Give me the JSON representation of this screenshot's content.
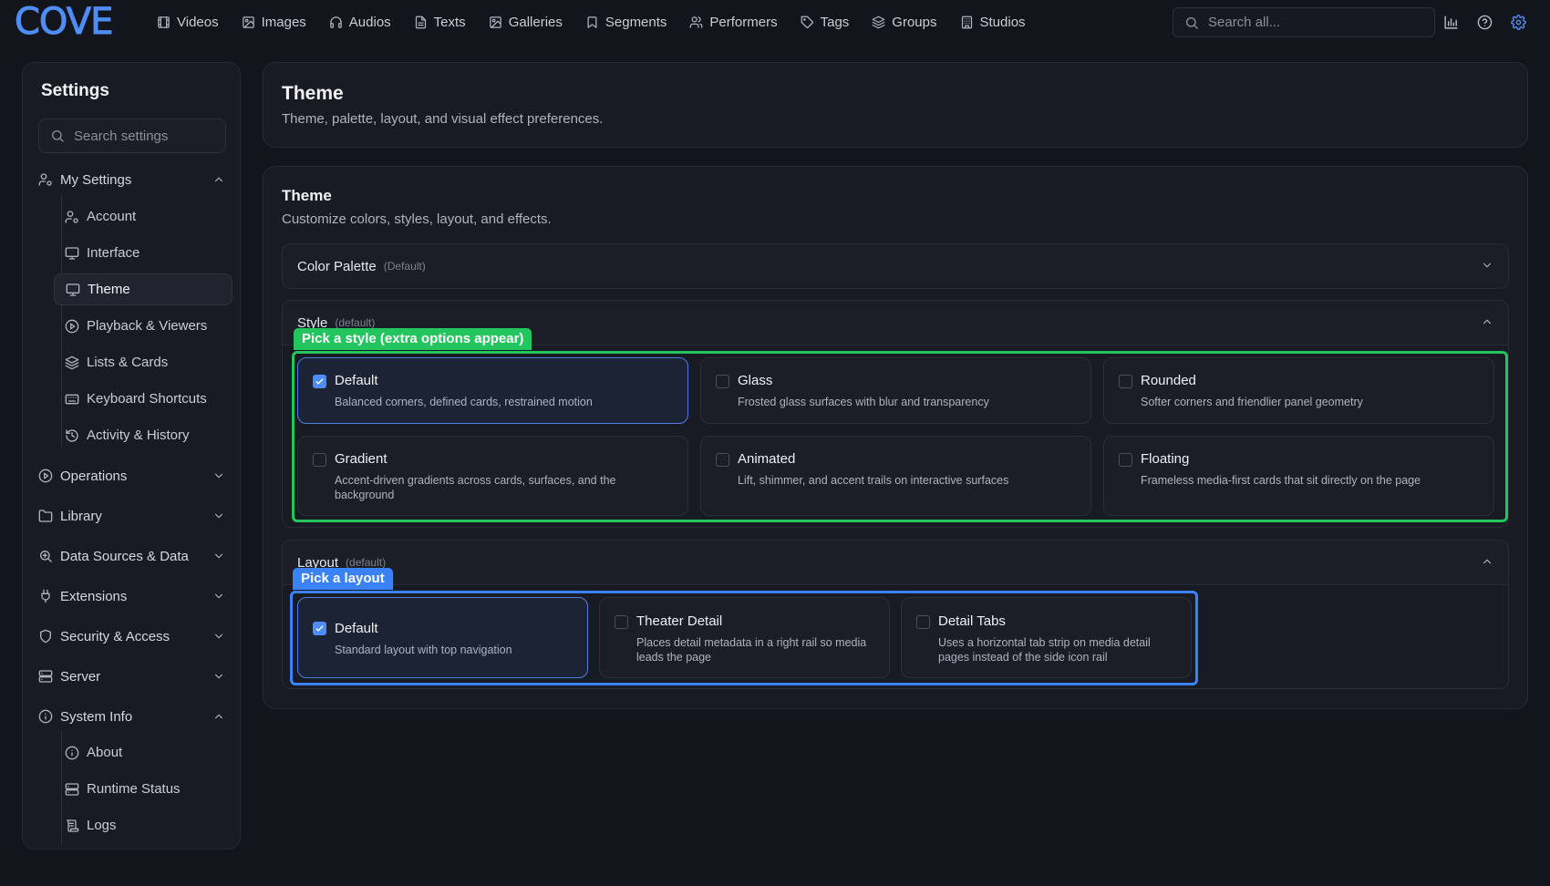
{
  "app": {
    "logo": "COVE"
  },
  "nav": [
    {
      "label": "Videos",
      "icon": "film-icon"
    },
    {
      "label": "Images",
      "icon": "image-icon"
    },
    {
      "label": "Audios",
      "icon": "headphones-icon"
    },
    {
      "label": "Texts",
      "icon": "file-text-icon"
    },
    {
      "label": "Galleries",
      "icon": "gallery-icon"
    },
    {
      "label": "Segments",
      "icon": "bookmark-icon"
    },
    {
      "label": "Performers",
      "icon": "users-icon"
    },
    {
      "label": "Tags",
      "icon": "tag-icon"
    },
    {
      "label": "Groups",
      "icon": "layers-icon"
    },
    {
      "label": "Studios",
      "icon": "building-icon"
    }
  ],
  "search": {
    "placeholder": "Search all..."
  },
  "colors": {
    "accent": "#4e8df5",
    "style_highlight": "#22c55e",
    "layout_highlight": "#3b82f6"
  },
  "sidebar": {
    "title": "Settings",
    "search_placeholder": "Search settings",
    "my_settings": {
      "label": "My Settings",
      "items": [
        "Account",
        "Interface",
        "Theme",
        "Playback & Viewers",
        "Lists & Cards",
        "Keyboard Shortcuts",
        "Activity & History"
      ],
      "active": "Theme"
    },
    "groups": [
      "Operations",
      "Library",
      "Data Sources & Data",
      "Extensions",
      "Security & Access",
      "Server"
    ],
    "system_info": {
      "label": "System Info",
      "items": [
        "About",
        "Runtime Status",
        "Logs"
      ]
    }
  },
  "header": {
    "title": "Theme",
    "subtitle": "Theme, palette, layout, and visual effect preferences."
  },
  "theme_card": {
    "title": "Theme",
    "description": "Customize colors, styles, layout, and effects.",
    "palette": {
      "label": "Color Palette",
      "value": "(Default)"
    },
    "style": {
      "label": "Style",
      "value": "(default)",
      "highlight_label": "Pick a style (extra options appear)",
      "options": [
        {
          "title": "Default",
          "desc": "Balanced corners, defined cards, restrained motion",
          "selected": true
        },
        {
          "title": "Glass",
          "desc": "Frosted glass surfaces with blur and transparency",
          "selected": false
        },
        {
          "title": "Rounded",
          "desc": "Softer corners and friendlier panel geometry",
          "selected": false
        },
        {
          "title": "Gradient",
          "desc": "Accent-driven gradients across cards, surfaces, and the background",
          "selected": false
        },
        {
          "title": "Animated",
          "desc": "Lift, shimmer, and accent trails on interactive surfaces",
          "selected": false
        },
        {
          "title": "Floating",
          "desc": "Frameless media-first cards that sit directly on the page",
          "selected": false
        }
      ]
    },
    "layout": {
      "label": "Layout",
      "value": "(default)",
      "highlight_label": "Pick a layout",
      "options": [
        {
          "title": "Default",
          "desc": "Standard layout with top navigation",
          "selected": true
        },
        {
          "title": "Theater Detail",
          "desc": "Places detail metadata in a right rail so media leads the page",
          "selected": false
        },
        {
          "title": "Detail Tabs",
          "desc": "Uses a horizontal tab strip on media detail pages instead of the side icon rail",
          "selected": false
        }
      ]
    }
  }
}
